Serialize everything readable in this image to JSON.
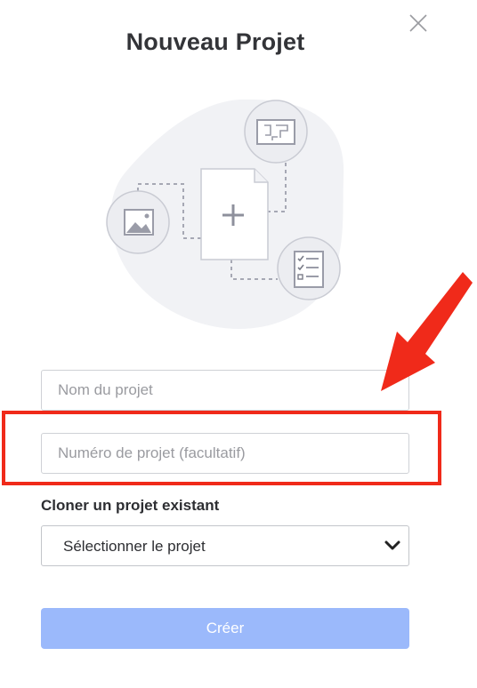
{
  "dialog": {
    "title": "Nouveau Projet",
    "close_icon": "close-icon"
  },
  "form": {
    "name_placeholder": "Nom du projet",
    "number_placeholder": "Numéro de projet (facultatif)",
    "clone_label": "Cloner un projet existant",
    "clone_select_value": "Sélectionner le projet",
    "create_label": "Créer"
  },
  "annotation": {
    "highlight_color": "#f02a1a"
  },
  "colors": {
    "title": "#333438",
    "primary_disabled": "#9bb9fb",
    "illustration_blob": "#f1f2f5",
    "illustration_stroke": "#c9cbd3",
    "illustration_icon": "#9a9ca8"
  }
}
